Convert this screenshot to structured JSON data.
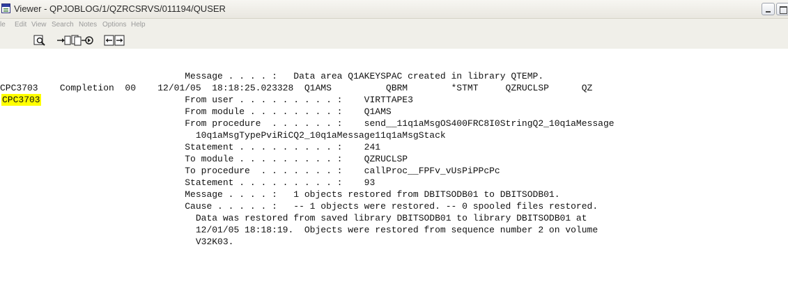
{
  "window": {
    "title": "Viewer - QPJOBLOG/1/QZRCSRVS/011194/QUSER"
  },
  "menu": {
    "items": [
      "File",
      "Edit",
      "View",
      "Search",
      "Notes",
      "Options",
      "Help"
    ],
    "first_visible_text": "le"
  },
  "toolbar": {
    "buttons": [
      "zoom-icon",
      "export-icon",
      "copy-icon",
      "refresh-icon",
      "split-view-icon"
    ]
  },
  "log": {
    "highlighted_id": "CPC3703",
    "lines": [
      "                                  Message . . . . :   Data area Q1AKEYSPAC created in library QTEMP.",
      "CPC3703    Completion  00    12/01/05  18:18:25.023328  Q1AMS          QBRM        *STMT     QZRUCLSP      QZ",
      "                                  From user . . . . . . . . . :    VIRTTAPE3",
      "                                  From module . . . . . . . . :    Q1AMS",
      "                                  From procedure  . . . . . . :    send__11q1aMsgOS400FRC8I0StringQ2_10q1aMessage",
      "                                    10q1aMsgTypePviRiCQ2_10q1aMessage11q1aMsgStack",
      "                                  Statement . . . . . . . . . :    241",
      "                                  To module . . . . . . . . . :    QZRUCLSP",
      "                                  To procedure  . . . . . . . :    callProc__FPFv_vUsPiPPcPc",
      "                                  Statement . . . . . . . . . :    93",
      "                                  Message . . . . :   1 objects restored from DBITSODB01 to DBITSODB01.",
      "                                  Cause . . . . . :   -- 1 objects were restored. -- 0 spooled files restored.",
      "                                    Data was restored from saved library DBITSODB01 to library DBITSODB01 at",
      "                                    12/01/05 18:18:19.  Objects were restored from sequence number 2 on volume",
      "                                    V32K03."
    ]
  }
}
